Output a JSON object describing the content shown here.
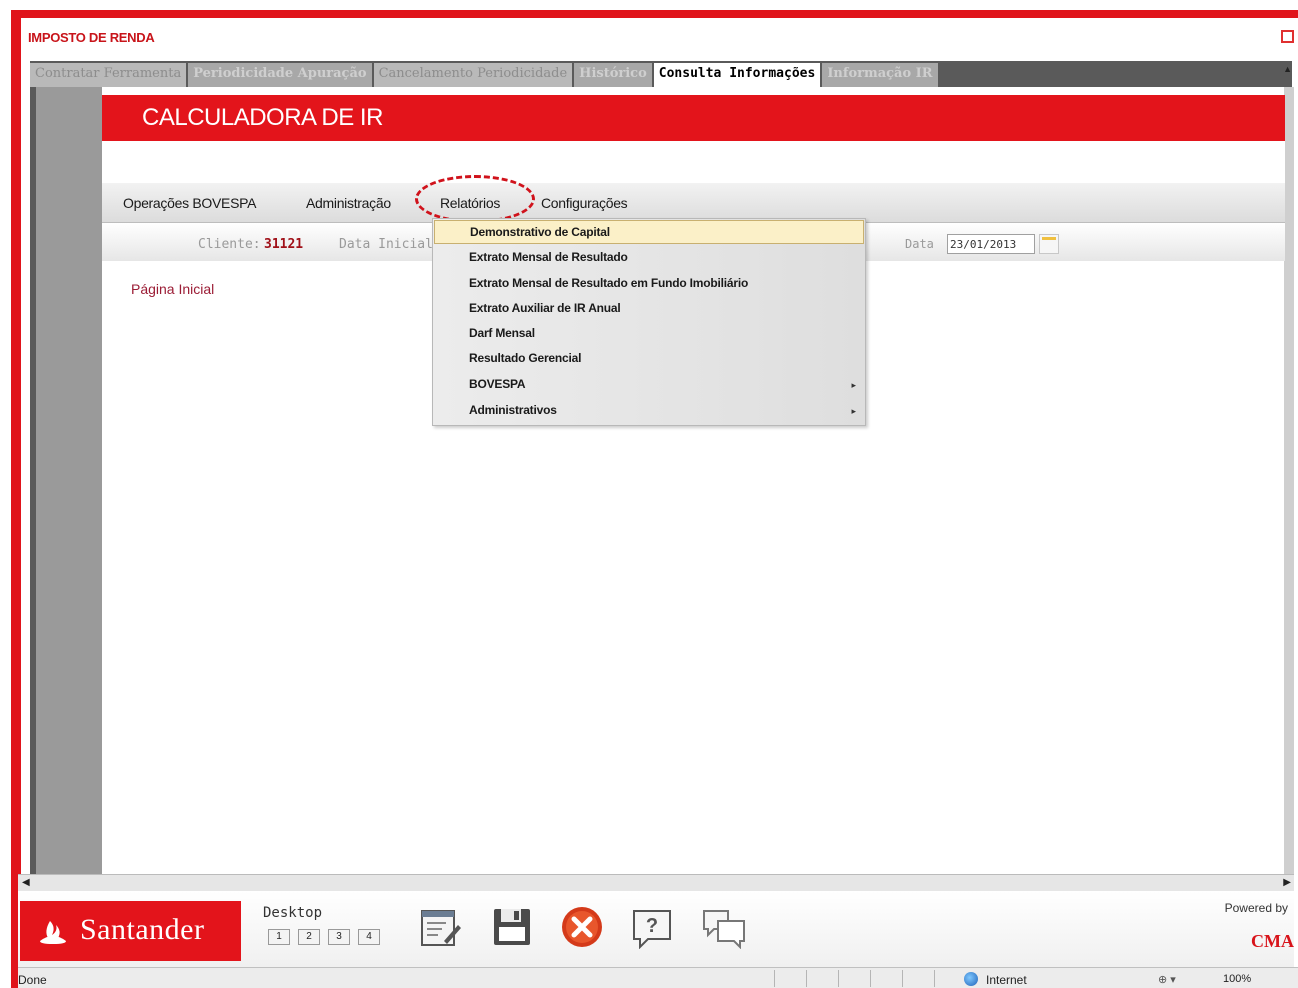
{
  "window": {
    "title": "IMPOSTO DE RENDA"
  },
  "tabs": [
    {
      "label": "Contratar Ferramenta",
      "state": "inactive"
    },
    {
      "label": "Periodicidade Apuração",
      "state": "inactive"
    },
    {
      "label": "Cancelamento Periodicidade",
      "state": "inactive"
    },
    {
      "label": "Histórico",
      "state": "inactive"
    },
    {
      "label": "Consulta Informações",
      "state": "active"
    },
    {
      "label": "Informação IR",
      "state": "inactive"
    }
  ],
  "app": {
    "title": "CALCULADORA DE IR",
    "brand_color": "#e3141b"
  },
  "menu": {
    "items": [
      "Operações BOVESPA",
      "Administração",
      "Relatórios",
      "Configurações"
    ],
    "open_item": "Relatórios"
  },
  "client_bar": {
    "client_label": "Cliente:",
    "client_value": "31121",
    "date_start_label": "Data Inicial",
    "date_label": "Data",
    "date_value": "23/01/2013"
  },
  "content": {
    "home_link": "Página Inicial"
  },
  "dropdown": {
    "items": [
      {
        "label": "Demonstrativo de Capital",
        "selected": true,
        "submenu": false
      },
      {
        "label": "Extrato Mensal de Resultado",
        "selected": false,
        "submenu": false
      },
      {
        "label": "Extrato Mensal de Resultado em Fundo Imobiliário",
        "selected": false,
        "submenu": false
      },
      {
        "label": "Extrato Auxiliar de IR Anual",
        "selected": false,
        "submenu": false
      },
      {
        "label": "Darf Mensal",
        "selected": false,
        "submenu": false
      },
      {
        "label": "Resultado Gerencial",
        "selected": false,
        "submenu": false
      },
      {
        "label": "BOVESPA",
        "selected": false,
        "submenu": true
      },
      {
        "label": "Administrativos",
        "selected": false,
        "submenu": true
      }
    ]
  },
  "footer": {
    "brand": "Santander",
    "desktop_label": "Desktop",
    "desktop_buttons": [
      "1",
      "2",
      "3",
      "4"
    ],
    "tools": [
      "notepad-icon",
      "save-disk-icon",
      "close-red-icon",
      "help-icon",
      "chat-icon"
    ],
    "powered_label": "Powered by",
    "powered_brand": "CMA"
  },
  "statusbar": {
    "status": "Done",
    "zone": "Internet",
    "zoom": "100%"
  }
}
